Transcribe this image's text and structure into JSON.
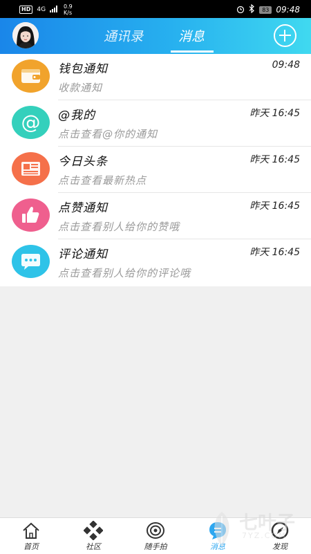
{
  "status_bar": {
    "hd": "HD",
    "network": "4G",
    "speed_value": "0.9",
    "speed_unit": "K/s",
    "battery": "83",
    "time": "09:48"
  },
  "header": {
    "tabs": [
      {
        "label": "通讯录",
        "active": false
      },
      {
        "label": "消息",
        "active": true
      }
    ]
  },
  "messages": [
    {
      "title": "钱包通知",
      "subtitle": "收款通知",
      "time": "09:48",
      "icon": "wallet-icon",
      "color": "#f1a32c"
    },
    {
      "title": "@我的",
      "subtitle": "点击查看@你的通知",
      "time": "昨天 16:45",
      "icon": "at-icon",
      "color": "#34d0bc"
    },
    {
      "title": "今日头条",
      "subtitle": "点击查看最新热点",
      "time": "昨天 16:45",
      "icon": "newspaper-icon",
      "color": "#f5704a"
    },
    {
      "title": "点赞通知",
      "subtitle": "点击查看别人给你的赞哦",
      "time": "昨天 16:45",
      "icon": "thumbs-up-icon",
      "color": "#ef5f8e"
    },
    {
      "title": "评论通知",
      "subtitle": "点击查看别人给你的评论哦",
      "time": "昨天 16:45",
      "icon": "comment-icon",
      "color": "#2ec3e8"
    }
  ],
  "bottom_nav": [
    {
      "label": "首页",
      "icon": "home-icon",
      "active": false
    },
    {
      "label": "社区",
      "icon": "community-icon",
      "active": false
    },
    {
      "label": "随手拍",
      "icon": "camera-icon",
      "active": false
    },
    {
      "label": "消息",
      "icon": "message-icon",
      "active": true
    },
    {
      "label": "发现",
      "icon": "discover-icon",
      "active": false
    }
  ],
  "watermark": {
    "title": "七叶子",
    "subtitle": "7YZ.COM"
  }
}
